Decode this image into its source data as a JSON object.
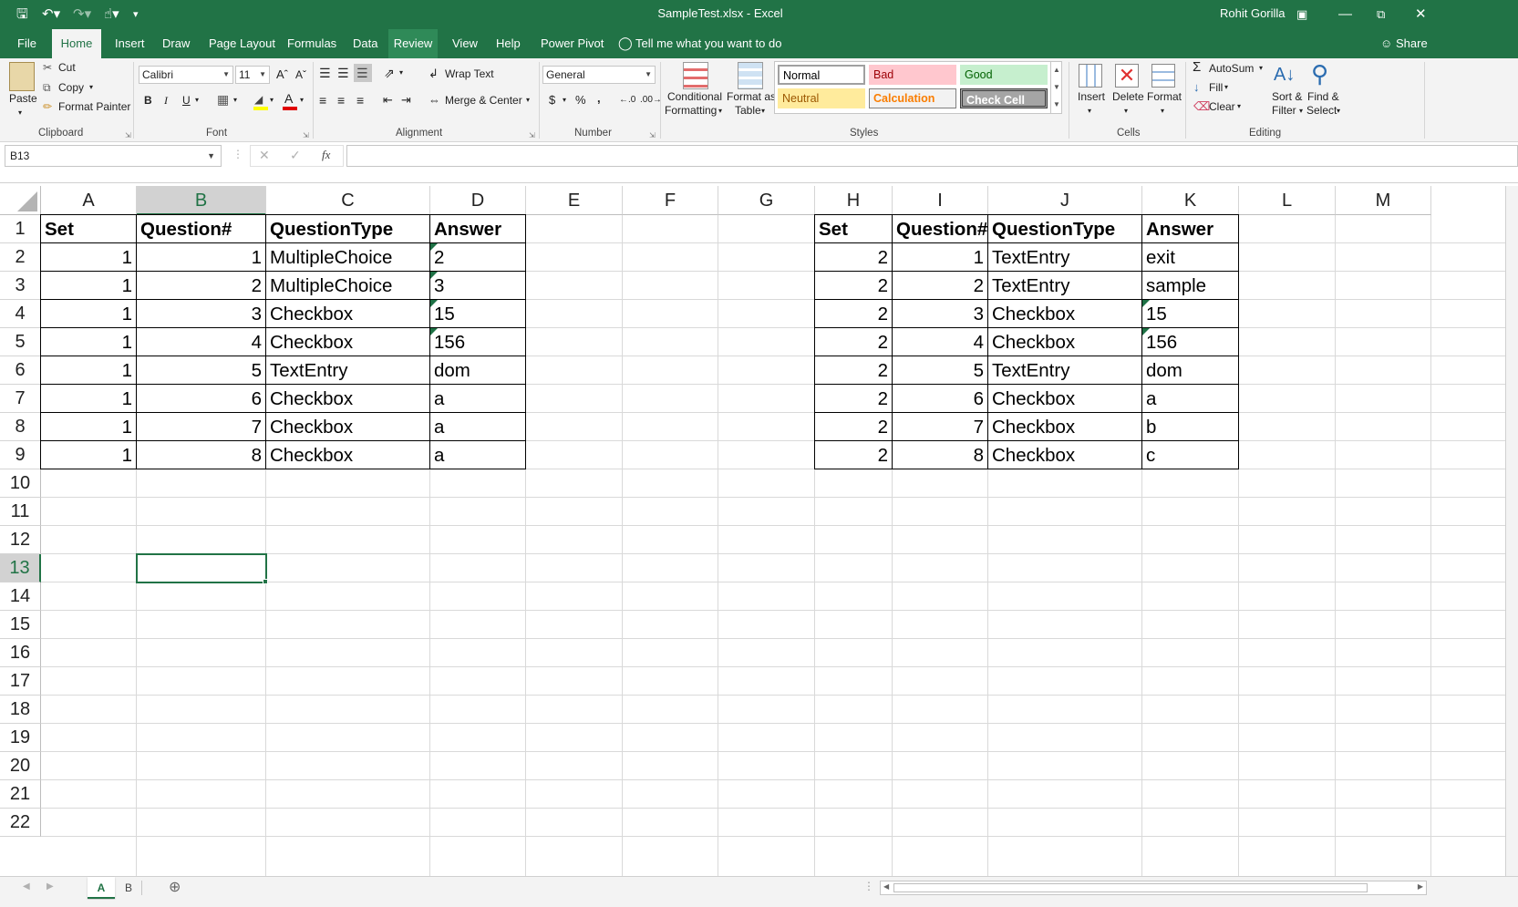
{
  "window": {
    "title": "SampleTest.xlsx  -  Excel",
    "user": "Rohit Gorilla",
    "share": "Share"
  },
  "tabs": [
    "File",
    "Home",
    "Insert",
    "Draw",
    "Page Layout",
    "Formulas",
    "Data",
    "Review",
    "View",
    "Help",
    "Power Pivot"
  ],
  "tell_me": "Tell me what you want to do",
  "ribbon": {
    "clipboard": {
      "paste": "Paste",
      "cut": "Cut",
      "copy": "Copy",
      "format_painter": "Format Painter",
      "label": "Clipboard"
    },
    "font": {
      "name": "Calibri",
      "size": "11",
      "label": "Font",
      "bold": "B",
      "italic": "I",
      "underline": "U"
    },
    "alignment": {
      "wrap": "Wrap Text",
      "merge": "Merge & Center",
      "label": "Alignment"
    },
    "number": {
      "format": "General",
      "currency": "$",
      "percent": "%",
      "comma": ",",
      "label": "Number"
    },
    "styles": {
      "conditional_1": "Conditional",
      "conditional_2": "Formatting",
      "format_table_1": "Format as",
      "format_table_2": "Table",
      "normal": "Normal",
      "bad": "Bad",
      "good": "Good",
      "neutral": "Neutral",
      "calculation": "Calculation",
      "check_cell": "Check Cell",
      "label": "Styles"
    },
    "cells": {
      "insert": "Insert",
      "delete": "Delete",
      "format": "Format",
      "label": "Cells"
    },
    "editing": {
      "autosum": "AutoSum",
      "fill": "Fill",
      "clear": "Clear",
      "sort_1": "Sort &",
      "sort_2": "Filter",
      "find_1": "Find &",
      "find_2": "Select",
      "label": "Editing"
    }
  },
  "formula": {
    "name_box": "B13",
    "content": "",
    "fx": "fx"
  },
  "columns": [
    "A",
    "B",
    "C",
    "D",
    "E",
    "F",
    "G",
    "H",
    "I",
    "J",
    "K",
    "L",
    "M"
  ],
  "rows": [
    "1",
    "2",
    "3",
    "4",
    "5",
    "6",
    "7",
    "8",
    "9",
    "10",
    "11",
    "12",
    "13",
    "14",
    "15",
    "16",
    "17",
    "18",
    "19",
    "20",
    "21",
    "22"
  ],
  "selected_cell": {
    "col": "B",
    "row": "13"
  },
  "table1": {
    "headers": [
      "Set",
      "Question#",
      "QuestionType",
      "Answer"
    ],
    "rows": [
      [
        "1",
        "1",
        "MultipleChoice",
        "2"
      ],
      [
        "1",
        "2",
        "MultipleChoice",
        "3"
      ],
      [
        "1",
        "3",
        "Checkbox",
        "15"
      ],
      [
        "1",
        "4",
        "Checkbox",
        "156"
      ],
      [
        "1",
        "5",
        "TextEntry",
        "dom"
      ],
      [
        "1",
        "6",
        "Checkbox",
        "a"
      ],
      [
        "1",
        "7",
        "Checkbox",
        "a"
      ],
      [
        "1",
        "8",
        "Checkbox",
        "a"
      ]
    ]
  },
  "table2": {
    "headers": [
      "Set",
      "Question#",
      "QuestionType",
      "Answer"
    ],
    "rows": [
      [
        "2",
        "1",
        "TextEntry",
        "exit"
      ],
      [
        "2",
        "2",
        "TextEntry",
        "sample"
      ],
      [
        "2",
        "3",
        "Checkbox",
        "15"
      ],
      [
        "2",
        "4",
        "Checkbox",
        "156"
      ],
      [
        "2",
        "5",
        "TextEntry",
        "dom"
      ],
      [
        "2",
        "6",
        "Checkbox",
        "a"
      ],
      [
        "2",
        "7",
        "Checkbox",
        "b"
      ],
      [
        "2",
        "8",
        "Checkbox",
        "c"
      ]
    ]
  },
  "sheets": [
    "A",
    "B"
  ],
  "active_sheet": "A",
  "colors": {
    "excel_green": "#217346",
    "error_triangle": "#1e7145"
  }
}
